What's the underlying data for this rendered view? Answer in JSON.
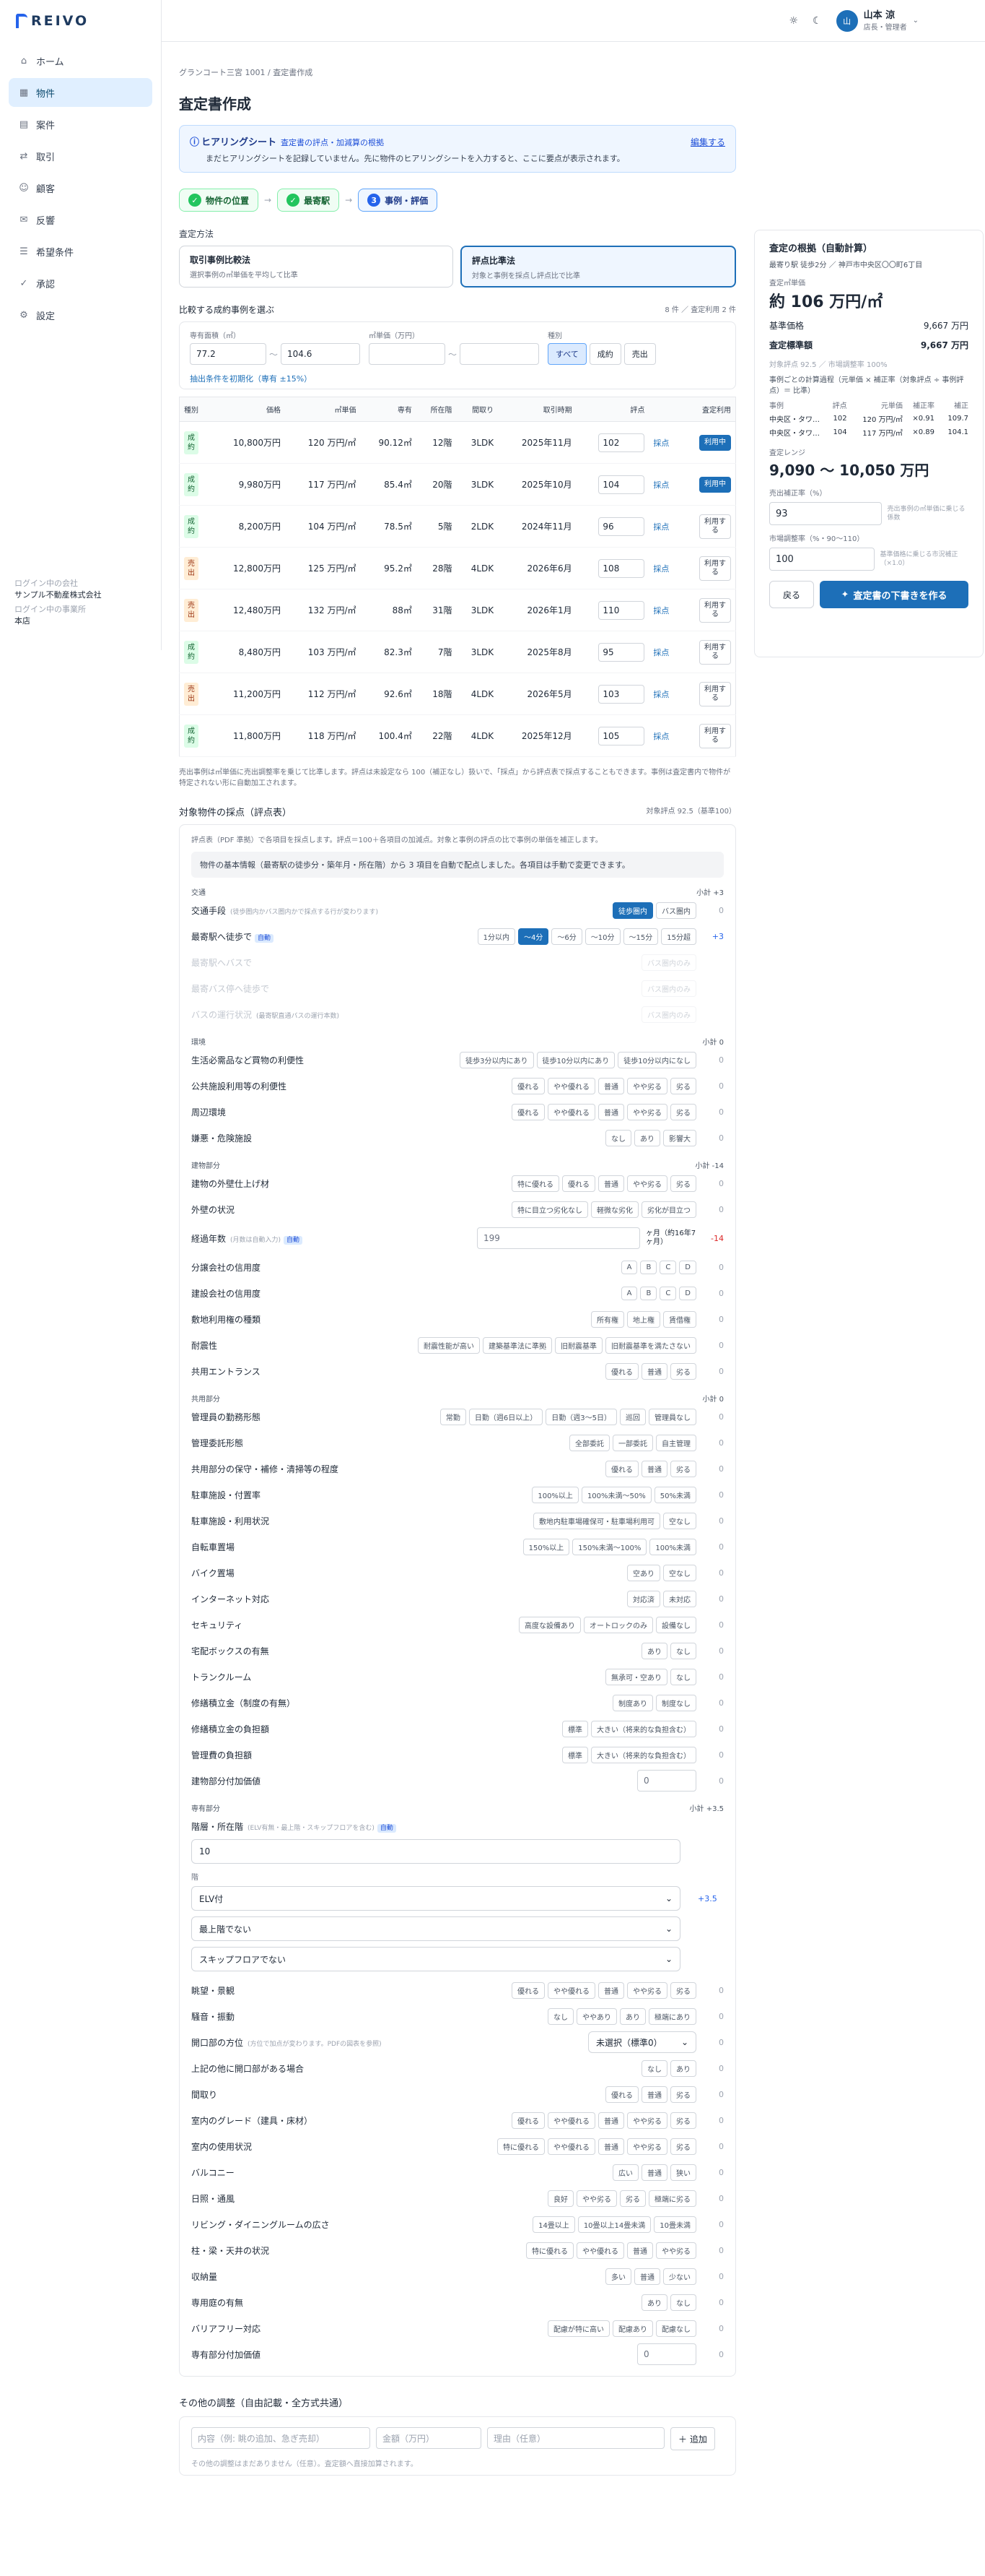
{
  "sidebar": {
    "brand": "REIVO",
    "items": [
      {
        "label": "ホーム",
        "icon": "home-icon"
      },
      {
        "label": "物件",
        "icon": "building-icon"
      },
      {
        "label": "案件",
        "icon": "folder-icon"
      },
      {
        "label": "取引",
        "icon": "deal-icon"
      },
      {
        "label": "顧客",
        "icon": "user-icon"
      },
      {
        "label": "反響",
        "icon": "inbox-icon"
      },
      {
        "label": "希望条件",
        "icon": "filter-icon"
      },
      {
        "label": "承認",
        "icon": "check-icon"
      },
      {
        "label": "設定",
        "icon": "gear-icon"
      }
    ],
    "company_label": "ログイン中の会社",
    "company": "サンプル不動産株式会社",
    "office_label": "ログイン中の事業所",
    "office": "本店"
  },
  "topbar": {
    "avatar": "山",
    "user_name": "山本 涼",
    "user_role": "店長・管理者"
  },
  "page": {
    "breadcrumb": "グランコート三宮 1001 / 査定書作成",
    "title": "査定書作成"
  },
  "hearing": {
    "title": "ヒアリングシート",
    "subtitle": "査定書の評点・加減算の根拠",
    "desc": "まだヒアリングシートを記録していません。先に物件のヒアリングシートを入力すると、ここに要点が表示されます。",
    "edit": "編集する"
  },
  "steps": [
    {
      "num": "✓",
      "label": "物件の位置"
    },
    {
      "num": "✓",
      "label": "最寄駅"
    },
    {
      "num": "3",
      "label": "事例・評価"
    }
  ],
  "method": {
    "label": "査定方法",
    "options": [
      {
        "title": "取引事例比較法",
        "desc": "選択事例の㎡単価を平均して比準"
      },
      {
        "title": "評点比準法",
        "desc": "対象と事例を採点し評点比で比準"
      }
    ]
  },
  "cases": {
    "header": "比較する成約事例を選ぶ",
    "count": "8 件 ／ 査定利用 2 件",
    "area_label": "専有面積（㎡）",
    "area_min": "77.2",
    "area_max": "104.6",
    "unit_label": "㎡単価（万円）",
    "type_label": "種別",
    "types": [
      "すべて",
      "成約",
      "売出"
    ],
    "reset": "抽出条件を初期化（専有 ±15%）",
    "columns": [
      "種別",
      "価格",
      "㎡単価",
      "専有",
      "所在階",
      "間取り",
      "取引時期",
      "評点",
      "",
      "査定利用"
    ],
    "rows": [
      {
        "type": "成約",
        "price": "10,800万円",
        "unit": "120 万円/㎡",
        "area": "90.12㎡",
        "floor": "12階",
        "layout": "3LDK",
        "date": "2025年11月",
        "score": "102",
        "link": "採点",
        "use": "利用中"
      },
      {
        "type": "成約",
        "price": "9,980万円",
        "unit": "117 万円/㎡",
        "area": "85.4㎡",
        "floor": "20階",
        "layout": "3LDK",
        "date": "2025年10月",
        "score": "104",
        "link": "採点",
        "use": "利用中"
      },
      {
        "type": "成約",
        "price": "8,200万円",
        "unit": "104 万円/㎡",
        "area": "78.5㎡",
        "floor": "5階",
        "layout": "2LDK",
        "date": "2024年11月",
        "score": "96",
        "link": "採点",
        "use": "利用する"
      },
      {
        "type": "売出",
        "price": "12,800万円",
        "unit": "125 万円/㎡",
        "area": "95.2㎡",
        "floor": "28階",
        "layout": "4LDK",
        "date": "2026年6月",
        "score": "108",
        "link": "採点",
        "use": "利用する"
      },
      {
        "type": "売出",
        "price": "12,480万円",
        "unit": "132 万円/㎡",
        "area": "88㎡",
        "floor": "31階",
        "layout": "3LDK",
        "date": "2026年1月",
        "score": "110",
        "link": "採点",
        "use": "利用する"
      },
      {
        "type": "成約",
        "price": "8,480万円",
        "unit": "103 万円/㎡",
        "area": "82.3㎡",
        "floor": "7階",
        "layout": "3LDK",
        "date": "2025年8月",
        "score": "95",
        "link": "採点",
        "use": "利用する"
      },
      {
        "type": "売出",
        "price": "11,200万円",
        "unit": "112 万円/㎡",
        "area": "92.6㎡",
        "floor": "18階",
        "layout": "4LDK",
        "date": "2026年5月",
        "score": "103",
        "link": "採点",
        "use": "利用する"
      },
      {
        "type": "成約",
        "price": "11,800万円",
        "unit": "118 万円/㎡",
        "area": "100.4㎡",
        "floor": "22階",
        "layout": "4LDK",
        "date": "2025年12月",
        "score": "105",
        "link": "採点",
        "use": "利用する"
      }
    ],
    "note": "売出事例は㎡単価に売出調整率を乗じて比準します。評点は未設定なら 100（補正なし）扱いで、「採点」から評点表で採点することもできます。事例は査定書内で物件が特定されない形に自動加工されます。"
  },
  "score": {
    "header": "対象物件の採点（評点表）",
    "total": "対象評点 92.5（基準100）",
    "desc": "評点表（PDF 準拠）で各項目を採点します。評点＝100＋各項目の加減点。対象と事例の評点の比で事例の単価を補正します。",
    "autonote": "物件の基本情報（最寄駅の徒歩分・築年月・所在階）から 3 項目を自動で配点しました。各項目は手動で変更できます。",
    "g1": {
      "name": "交通",
      "sub": "小計 +3"
    },
    "transport": {
      "label": "交通手段",
      "hint": "(徒歩圏内かバス圏内かで採点する行が変わります)",
      "chips": [
        "徒歩圏内",
        "バス圏内"
      ],
      "score": "0"
    },
    "walk": {
      "label": "最寄駅へ徒歩で",
      "auto": "自動",
      "chips": [
        "1分以内",
        "〜4分",
        "〜6分",
        "〜10分",
        "〜15分",
        "15分超"
      ],
      "score": "+3"
    },
    "bus1": {
      "label": "最寄駅へバスで",
      "chips": [
        "バス圏内のみ"
      ]
    },
    "bus2": {
      "label": "最寄バス停へ徒歩で",
      "chips": [
        "バス圏内のみ"
      ]
    },
    "bus3": {
      "label": "バスの運行状況",
      "hint": "(最寄駅直通バスの運行本数)",
      "chips": [
        "バス圏内のみ"
      ]
    },
    "g2": {
      "name": "環境",
      "sub": "小計 0"
    },
    "env": [
      {
        "label": "生活必需品など買物の利便性",
        "chips": [
          "徒歩3分以内にあり",
          "徒歩10分以内にあり",
          "徒歩10分以内になし"
        ],
        "score": "0"
      },
      {
        "label": "公共施設利用等の利便性",
        "chips": [
          "優れる",
          "やや優れる",
          "普通",
          "やや劣る",
          "劣る"
        ],
        "score": "0"
      },
      {
        "label": "周辺環境",
        "chips": [
          "優れる",
          "やや優れる",
          "普通",
          "やや劣る",
          "劣る"
        ],
        "score": "0"
      },
      {
        "label": "嫌悪・危険施設",
        "chips": [
          "なし",
          "あり",
          "影響大"
        ],
        "score": "0"
      }
    ],
    "g3": {
      "name": "建物部分",
      "sub": "小計 -14"
    },
    "bld1": [
      {
        "label": "建物の外壁仕上げ材",
        "chips": [
          "特に優れる",
          "優れる",
          "普通",
          "やや劣る",
          "劣る"
        ],
        "score": "0"
      },
      {
        "label": "外壁の状況",
        "chips": [
          "特に目立つ劣化なし",
          "軽微な劣化",
          "劣化が目立つ"
        ],
        "score": "0"
      }
    ],
    "age": {
      "label": "経過年数",
      "hint": "(月数は自動入力)",
      "auto": "自動",
      "value": "199",
      "unit": "ヶ月（約16年7ヶ月）",
      "score": "-14"
    },
    "bld2": [
      {
        "label": "分譲会社の信用度",
        "chips": [
          "A",
          "B",
          "C",
          "D"
        ],
        "score": "0"
      },
      {
        "label": "建設会社の信用度",
        "chips": [
          "A",
          "B",
          "C",
          "D"
        ],
        "score": "0"
      },
      {
        "label": "敷地利用権の種類",
        "chips": [
          "所有権",
          "地上権",
          "賃借権"
        ],
        "score": "0"
      },
      {
        "label": "耐震性",
        "chips": [
          "耐震性能が高い",
          "建築基準法に準拠",
          "旧耐震基準",
          "旧耐震基準を満たさない"
        ],
        "score": "0"
      },
      {
        "label": "共用エントランス",
        "chips": [
          "優れる",
          "普通",
          "劣る"
        ],
        "score": "0"
      }
    ],
    "g4": {
      "name": "共用部分",
      "sub": "小計 0"
    },
    "common": [
      {
        "label": "管理員の勤務形態",
        "chips": [
          "常勤",
          "日勤（週6日以上）",
          "日勤（週3〜5日）",
          "巡回",
          "管理員なし"
        ],
        "score": "0"
      },
      {
        "label": "管理委託形態",
        "chips": [
          "全部委託",
          "一部委託",
          "自主管理"
        ],
        "score": "0"
      },
      {
        "label": "共用部分の保守・補修・清掃等の程度",
        "chips": [
          "優れる",
          "普通",
          "劣る"
        ],
        "score": "0"
      },
      {
        "label": "駐車施設・付置率",
        "chips": [
          "100%以上",
          "100%未満〜50%",
          "50%未満"
        ],
        "score": "0"
      },
      {
        "label": "駐車施設・利用状況",
        "chips": [
          "敷地内駐車場確保可・駐車場利用可",
          "空なし"
        ],
        "score": "0"
      },
      {
        "label": "自転車置場",
        "chips": [
          "150%以上",
          "150%未満〜100%",
          "100%未満"
        ],
        "score": "0"
      },
      {
        "label": "バイク置場",
        "chips": [
          "空あり",
          "空なし"
        ],
        "score": "0"
      },
      {
        "label": "インターネット対応",
        "chips": [
          "対応済",
          "未対応"
        ],
        "score": "0"
      },
      {
        "label": "セキュリティ",
        "chips": [
          "高度な設備あり",
          "オートロックのみ",
          "設備なし"
        ],
        "score": "0"
      },
      {
        "label": "宅配ボックスの有無",
        "chips": [
          "あり",
          "なし"
        ],
        "score": "0"
      },
      {
        "label": "トランクルーム",
        "chips": [
          "無承可・空あり",
          "なし"
        ],
        "score": "0"
      },
      {
        "label": "修繕積立金（制度の有無）",
        "chips": [
          "制度あり",
          "制度なし"
        ],
        "score": "0"
      },
      {
        "label": "修繕積立金の負担額",
        "chips": [
          "標準",
          "大きい（将来的な負担含む）"
        ],
        "score": "0"
      },
      {
        "label": "管理費の負担額",
        "chips": [
          "標準",
          "大きい（将来的な負担含む）"
        ],
        "score": "0"
      }
    ],
    "extra1": {
      "label": "建物部分付加価値",
      "value": "0",
      "score": "0"
    },
    "g5": {
      "name": "専有部分",
      "sub": "小計 +3.5"
    },
    "floor": {
      "label": "階層・所在階",
      "hint": "(ELV有無・最上階・スキップフロアを含む)",
      "auto": "自動",
      "value": "10",
      "elv_label": "階",
      "elv": "ELV付",
      "top": "最上階でない",
      "skip": "スキップフロアでない",
      "score": "+3.5"
    },
    "priv1": [
      {
        "label": "眺望・景観",
        "chips": [
          "優れる",
          "やや優れる",
          "普通",
          "やや劣る",
          "劣る"
        ],
        "score": "0"
      },
      {
        "label": "騒音・振動",
        "chips": [
          "なし",
          "ややあり",
          "あり",
          "極端にあり"
        ],
        "score": "0"
      }
    ],
    "direction": {
      "label": "開口部の方位",
      "hint": "(方位で加点が変わります。PDFの図表を参照)",
      "value": "未選択（標準0）",
      "score": "0"
    },
    "priv2": [
      {
        "label": "上記の他に開口部がある場合",
        "chips": [
          "なし",
          "あり"
        ],
        "score": "0"
      },
      {
        "label": "間取り",
        "chips": [
          "優れる",
          "普通",
          "劣る"
        ],
        "score": "0"
      },
      {
        "label": "室内のグレード（建具・床材）",
        "chips": [
          "優れる",
          "やや優れる",
          "普通",
          "やや劣る",
          "劣る"
        ],
        "score": "0"
      },
      {
        "label": "室内の使用状況",
        "chips": [
          "特に優れる",
          "やや優れる",
          "普通",
          "やや劣る",
          "劣る"
        ],
        "score": "0"
      },
      {
        "label": "バルコニー",
        "chips": [
          "広い",
          "普通",
          "狭い"
        ],
        "score": "0"
      },
      {
        "label": "日照・通風",
        "chips": [
          "良好",
          "やや劣る",
          "劣る",
          "極端に劣る"
        ],
        "score": "0"
      },
      {
        "label": "リビング・ダイニングルームの広さ",
        "chips": [
          "14畳以上",
          "10畳以上14畳未満",
          "10畳未満"
        ],
        "score": "0"
      },
      {
        "label": "柱・梁・天井の状況",
        "chips": [
          "特に優れる",
          "やや優れる",
          "普通",
          "やや劣る"
        ],
        "score": "0"
      },
      {
        "label": "収納量",
        "chips": [
          "多い",
          "普通",
          "少ない"
        ],
        "score": "0"
      },
      {
        "label": "専用庭の有無",
        "chips": [
          "あり",
          "なし"
        ],
        "score": "0"
      },
      {
        "label": "バリアフリー対応",
        "chips": [
          "配慮が特に高い",
          "配慮あり",
          "配慮なし"
        ],
        "score": "0"
      }
    ],
    "extra2": {
      "label": "専有部分付加価値",
      "value": "0",
      "score": "0"
    }
  },
  "others": {
    "title": "その他の調整（自由記載・全方式共通）",
    "content_ph": "内容（例: 眺の追加、急ぎ売却）",
    "amount_ph": "金額（万円）",
    "reason_ph": "理由（任意）",
    "add": "＋ 追加",
    "note": "その他の調整はまだありません（任意）。査定額へ直接加算されます。"
  },
  "panel": {
    "title": "査定の根拠（自動計算）",
    "station": "最寄り駅 徒歩2分 ／ 神戸市中央区〇〇町6丁目",
    "unit_label": "査定㎡単価",
    "unit_value": "約 106 万円/㎡",
    "base_label": "基準価格",
    "base_value": "9,667 万円",
    "std_label": "査定標準額",
    "std_value": "9,667 万円",
    "eval_note": "対象評点 92.5 ／ 市場調整率 100%",
    "calc_note": "事例ごとの計算過程（元単価 × 補正率（対象評点 ÷ 事例評点）＝ 比準）",
    "tcols": [
      "事例",
      "評点",
      "元単価",
      "補正率",
      "補正"
    ],
    "trows": [
      [
        "中央区・タワ…",
        "102",
        "120 万円/㎡",
        "×0.91",
        "109.7"
      ],
      [
        "中央区・タワ…",
        "104",
        "117 万円/㎡",
        "×0.89",
        "104.1"
      ]
    ],
    "range_label": "査定レンジ",
    "range": "9,090 〜 10,050 万円",
    "sale_label": "売出補正率（%）",
    "sale_value": "93",
    "sale_hint": "売出事例の㎡単価に乗じる係数",
    "market_label": "市場調整率（%・90〜110）",
    "market_value": "100",
    "market_hint": "基準価格に乗じる市況補正（×1.0）",
    "back": "戻る",
    "primary": "査定書の下書きを作る"
  }
}
